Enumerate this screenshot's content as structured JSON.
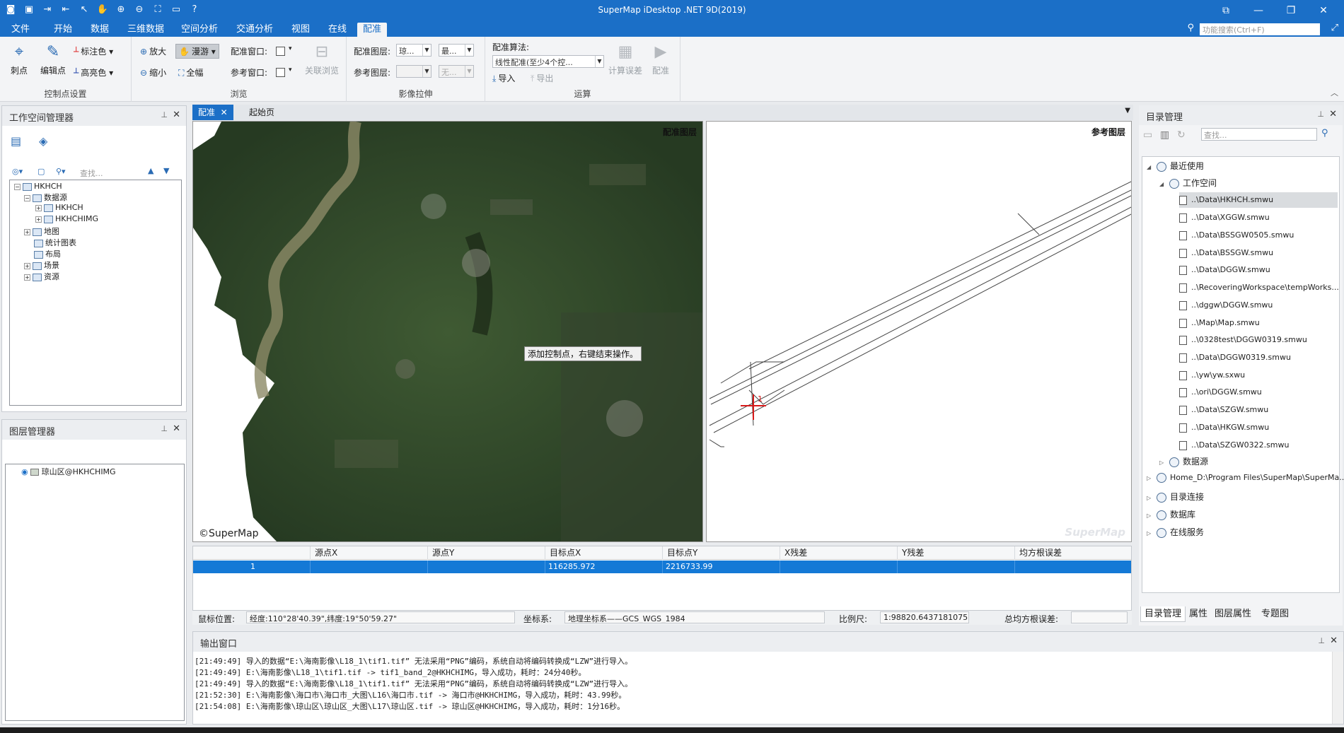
{
  "window": {
    "title": "SuperMap iDesktop .NET 9D(2019)"
  },
  "ribbon_tabs": [
    "文件",
    "开始",
    "数据",
    "三维数据",
    "空间分析",
    "交通分析",
    "视图",
    "在线",
    "配准"
  ],
  "search": {
    "placeholder": "功能搜索(Ctrl+F)"
  },
  "ribbon": {
    "control_points": {
      "label": "控制点设置",
      "puncture": "刺点",
      "edit_point": "编辑点",
      "mark_color": "标注色",
      "highlight_color": "高亮色"
    },
    "browse": {
      "label": "浏览",
      "zoom_in": "放大",
      "pan": "漫游",
      "zoom_out": "缩小",
      "full_extent": "全幅",
      "reg_window": "配准窗口:",
      "ref_window": "参考窗口:",
      "link_browse": "关联浏览"
    },
    "stretch": {
      "label": "影像拉伸",
      "reg_layer": "配准图层:",
      "ref_layer": "参考图层:",
      "reg_layer_value": "琼...",
      "reg_stretch_value": "最...",
      "ref_stretch_value": "无..."
    },
    "compute": {
      "label": "运算",
      "algorithm_label": "配准算法:",
      "algorithm_value": "线性配准(至少4个控...",
      "import": "导入",
      "export": "导出",
      "calc_error": "计算误差",
      "register": "配准"
    }
  },
  "workspace_manager": {
    "title": "工作空间管理器",
    "search_placeholder": "查找...",
    "tree": {
      "root": "HKHCH",
      "datasource": "数据源",
      "ds1": "HKHCH",
      "ds2": "HKHCHIMG",
      "map": "地图",
      "chart": "统计图表",
      "layout": "布局",
      "scene": "场景",
      "resource": "资源"
    }
  },
  "layer_manager": {
    "title": "图层管理器",
    "layer": "琼山区@HKHCHIMG"
  },
  "doc_tabs": [
    "配准",
    "起始页"
  ],
  "map": {
    "left_label": "配准图层",
    "right_label": "参考图层",
    "copyright": "©SuperMap",
    "tooltip": "添加控制点，右键结束操作。",
    "watermark": "SuperMap",
    "marker_id": "1"
  },
  "gcp_table": {
    "headers": [
      "",
      "源点X",
      "源点Y",
      "目标点X",
      "目标点Y",
      "X残差",
      "Y残差",
      "均方根误差"
    ],
    "rows": [
      [
        "1",
        "",
        "",
        "116285.972",
        "2216733.99",
        "",
        "",
        ""
      ]
    ]
  },
  "status": {
    "mouse_label": "鼠标位置:",
    "mouse_value": "经度:110°28'40.39\",纬度:19°50'59.27\"",
    "crs_label": "坐标系:",
    "crs_value": "地理坐标系——GCS_WGS_1984",
    "scale_label": "比例尺:",
    "scale_value": "1:98820.6437181075",
    "rmse_label": "总均方根误差:"
  },
  "output": {
    "title": "输出窗口",
    "lines": [
      "[21:49:49] 导入的数据“E:\\海南影像\\L18_1\\tif1.tif” 无法采用“PNG”编码，系统自动将编码转换成“LZW”进行导入。",
      "[21:49:49] E:\\海南影像\\L18_1\\tif1.tif     -> tif1_band_2@HKHCHIMG，导入成功，耗时：24分40秒。",
      "[21:49:49] 导入的数据“E:\\海南影像\\L18_1\\tif1.tif” 无法采用“PNG”编码，系统自动将编码转换成“LZW”进行导入。",
      "[21:52:30] E:\\海南影像\\海口市\\海口市_大图\\L16\\海口市.tif     -> 海口市@HKHCHIMG，导入成功，耗时：43.99秒。",
      "[21:54:08] E:\\海南影像\\琼山区\\琼山区_大图\\L17\\琼山区.tif     -> 琼山区@HKHCHIMG，导入成功，耗时：1分16秒。"
    ]
  },
  "catalog": {
    "title": "目录管理",
    "search_placeholder": "查找...",
    "recent": "最近使用",
    "workspace": "工作空间",
    "files": [
      "..\\Data\\HKHCH.smwu",
      "..\\Data\\XGGW.smwu",
      "..\\Data\\BSSGW0505.smwu",
      "..\\Data\\BSSGW.smwu",
      "..\\Data\\DGGW.smwu",
      "..\\RecoveringWorkspace\\tempWorks...",
      "..\\dggw\\DGGW.smwu",
      "..\\Map\\Map.smwu",
      "..\\0328test\\DGGW0319.smwu",
      "..\\Data\\DGGW0319.smwu",
      "..\\yw\\yw.sxwu",
      "..\\ori\\DGGW.smwu",
      "..\\Data\\SZGW.smwu",
      "..\\Data\\HKGW.smwu",
      "..\\Data\\SZGW0322.smwu"
    ],
    "datasource": "数据源",
    "home": "Home_D:\\Program Files\\SuperMap\\SuperMa...",
    "dir_connect": "目录连接",
    "database": "数据库",
    "online": "在线服务",
    "bottom_tabs": [
      "目录管理",
      "属性",
      "图层属性",
      "专题图"
    ]
  }
}
